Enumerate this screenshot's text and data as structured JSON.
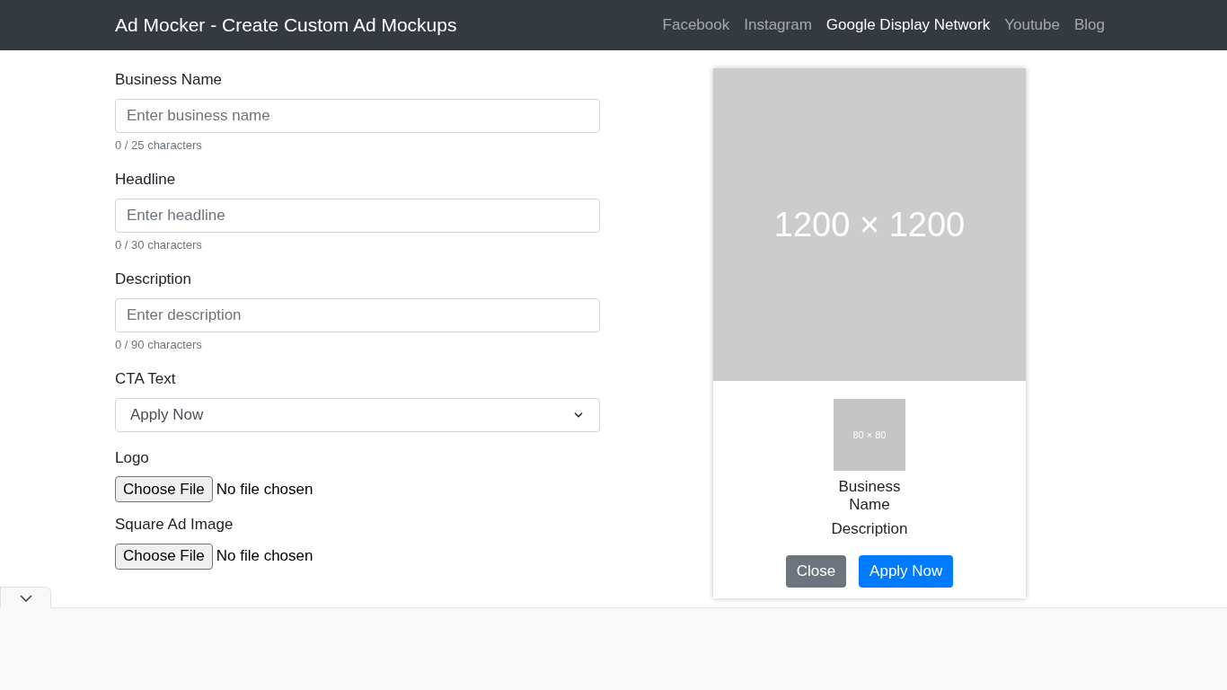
{
  "navbar": {
    "brand": "Ad Mocker - Create Custom Ad Mockups",
    "links": [
      {
        "label": "Facebook",
        "selected": false
      },
      {
        "label": "Instagram",
        "selected": false
      },
      {
        "label": "Google Display Network",
        "selected": true
      },
      {
        "label": "Youtube",
        "selected": false
      },
      {
        "label": "Blog",
        "selected": false
      }
    ]
  },
  "form": {
    "fields": [
      {
        "kind": "text",
        "label": "Business Name",
        "placeholder": "Enter business name",
        "counter": "0 / 25 characters"
      },
      {
        "kind": "text",
        "label": "Headline",
        "placeholder": "Enter headline",
        "counter": "0 / 30 characters"
      },
      {
        "kind": "text",
        "label": "Description",
        "placeholder": "Enter description",
        "counter": "0 / 90 characters"
      },
      {
        "kind": "select",
        "label": "CTA Text",
        "value": "Apply Now"
      },
      {
        "kind": "file",
        "label": "Logo",
        "button": "Choose File",
        "status": "No file chosen"
      },
      {
        "kind": "file",
        "label": "Square Ad Image",
        "button": "Choose File",
        "status": "No file chosen"
      }
    ]
  },
  "preview": {
    "image_label": "1200 × 1200",
    "logo_label": "80 × 80",
    "business_name": "Business Name",
    "description": "Description",
    "buttons": [
      {
        "label": "Close",
        "kind": "secondary"
      },
      {
        "label": "Apply Now",
        "kind": "primary"
      }
    ]
  }
}
